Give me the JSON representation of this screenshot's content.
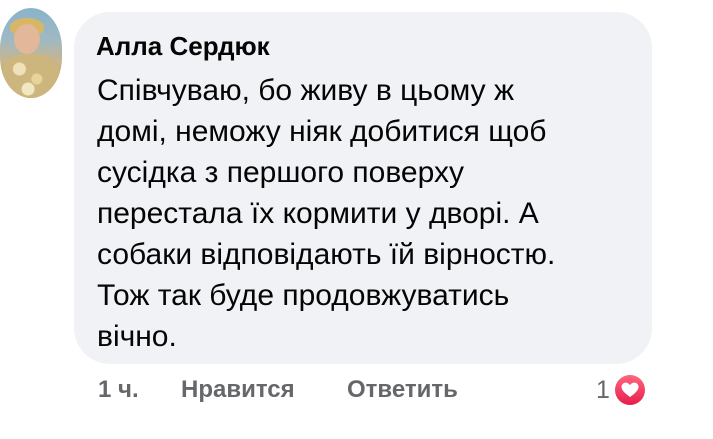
{
  "comment": {
    "author": "Алла Сердюк",
    "text_lines": [
      "Співчуваю, бо живу в цьому ж",
      "домі, неможу ніяк добитися щоб",
      "сусідка з першого поверху",
      "перестала їх кормити у дворі. А",
      "собаки відповідають їй вірностю.",
      "Тож так буде продовжуватись",
      "вічно."
    ],
    "time": "1 ч.",
    "like_label": "Нравится",
    "reply_label": "Ответить",
    "reaction_count": "1",
    "reaction_icon": "heart-icon",
    "colors": {
      "bubble": "#f0f2f5",
      "text": "#050505",
      "meta": "#65676b",
      "heart": "#e61e4d"
    }
  }
}
